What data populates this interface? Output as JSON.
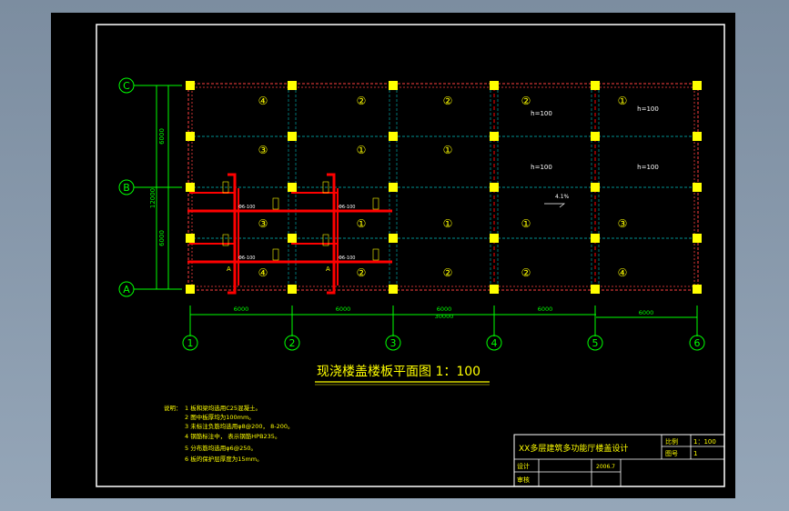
{
  "grid": {
    "row_axes": [
      "C",
      "B",
      "A"
    ],
    "col_axes": [
      "1",
      "2",
      "3",
      "4",
      "5",
      "6"
    ],
    "col_spacing": [
      "6000",
      "6000",
      "6000",
      "6000",
      "6000"
    ],
    "total_length": "30000",
    "row_spacing": [
      "6000",
      "6000"
    ],
    "total_width": "12000"
  },
  "slabs": {
    "row1": [
      "④",
      "②",
      "②",
      "②",
      "①"
    ],
    "row2": [
      "③",
      "①",
      "①",
      "",
      ""
    ],
    "row3": [
      "③",
      "①",
      "①",
      "①",
      "③"
    ],
    "row4": [
      "④",
      "②",
      "②",
      "②",
      "④"
    ],
    "h_labels": [
      "h=100",
      "h=100",
      "h=100",
      "h=100"
    ],
    "slope_label": "4.1%",
    "rebar_label": "Φ6-100",
    "section_mark": "A"
  },
  "drawing_title": "现浇楼盖楼板平面图 1：100",
  "notes": {
    "heading": "说明：",
    "lines": [
      "1  板和梁均选用C25混凝土。",
      "2  图中板厚均为100mm。",
      "3  未标注负筋均选用φ8@200，  8-200。",
      "4  钢筋标注中，   表示钢筋HPB235。",
      "5  分布筋均选用φ6@250。",
      "6  板的保护层厚度为15mm。"
    ]
  },
  "title_block": {
    "project": "XX多层建筑多功能厅楼盖设计",
    "scale_label": "比例",
    "scale_value": "1：100",
    "sheet_label": "图号",
    "sheet_value": "1",
    "design_label": "设计",
    "review_label": "审核",
    "date": "2006.7"
  },
  "colors": {
    "background": "#000000",
    "frame": "#ffffff",
    "axis": "#00ff00",
    "beam": "#ff0000",
    "column": "#ffff00",
    "slab_line": "#00c0c0",
    "text": "#ffff00"
  }
}
